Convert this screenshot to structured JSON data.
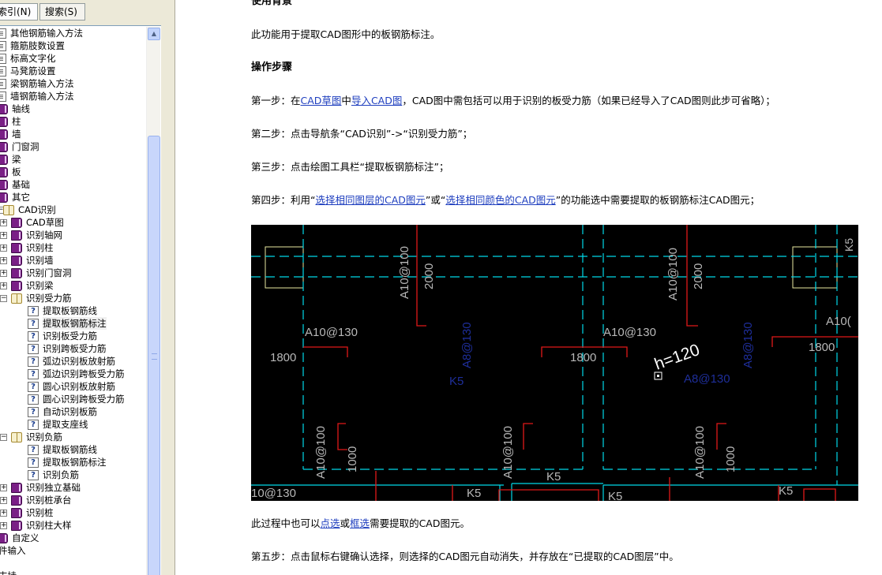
{
  "tabs": {
    "index": "索引(N)",
    "search": "搜索(S)"
  },
  "tree": [
    {
      "label": "其他钢筋输入方法",
      "icon": "page",
      "indent": 0
    },
    {
      "label": "箍筋肢数设置",
      "icon": "page",
      "indent": 0
    },
    {
      "label": "标高文字化",
      "icon": "page",
      "indent": 0
    },
    {
      "label": "马凳筋设置",
      "icon": "page",
      "indent": 0
    },
    {
      "label": "梁钢筋输入方法",
      "icon": "page",
      "indent": 0
    },
    {
      "label": "墙钢筋输入方法",
      "icon": "page",
      "indent": 0
    },
    {
      "label": "轴线",
      "icon": "book",
      "indent": 0
    },
    {
      "label": "柱",
      "icon": "book",
      "indent": 0
    },
    {
      "label": "墙",
      "icon": "book",
      "indent": 0
    },
    {
      "label": "门窗洞",
      "icon": "book",
      "indent": 0
    },
    {
      "label": "梁",
      "icon": "book",
      "indent": 0
    },
    {
      "label": "板",
      "icon": "book",
      "indent": 0
    },
    {
      "label": "基础",
      "icon": "book",
      "indent": 0
    },
    {
      "label": "其它",
      "icon": "book",
      "indent": 0
    },
    {
      "label": "CAD识别",
      "icon": "open",
      "indent": 0,
      "toggle": "−"
    },
    {
      "label": "CAD草图",
      "icon": "book",
      "indent": 1,
      "toggle": "+"
    },
    {
      "label": "识别轴网",
      "icon": "book",
      "indent": 1,
      "toggle": "+"
    },
    {
      "label": "识别柱",
      "icon": "book",
      "indent": 1,
      "toggle": "+"
    },
    {
      "label": "识别墙",
      "icon": "book",
      "indent": 1,
      "toggle": "+"
    },
    {
      "label": "识别门窗洞",
      "icon": "book",
      "indent": 1,
      "toggle": "+"
    },
    {
      "label": "识别梁",
      "icon": "book",
      "indent": 1,
      "toggle": "+"
    },
    {
      "label": "识别受力筋",
      "icon": "open",
      "indent": 1,
      "toggle": "−"
    },
    {
      "label": "提取板钢筋线",
      "icon": "q",
      "indent": 2
    },
    {
      "label": "提取板钢筋标注",
      "icon": "q",
      "indent": 2,
      "selected": true
    },
    {
      "label": "识别板受力筋",
      "icon": "q",
      "indent": 2
    },
    {
      "label": "识别跨板受力筋",
      "icon": "q",
      "indent": 2
    },
    {
      "label": "弧边识别板放射筋",
      "icon": "q",
      "indent": 2
    },
    {
      "label": "弧边识别跨板受力筋",
      "icon": "q",
      "indent": 2
    },
    {
      "label": "圆心识别板放射筋",
      "icon": "q",
      "indent": 2
    },
    {
      "label": "圆心识别跨板受力筋",
      "icon": "q",
      "indent": 2
    },
    {
      "label": "自动识别板筋",
      "icon": "q",
      "indent": 2
    },
    {
      "label": "提取支座线",
      "icon": "q",
      "indent": 2
    },
    {
      "label": "识别负筋",
      "icon": "open",
      "indent": 1,
      "toggle": "−"
    },
    {
      "label": "提取板钢筋线",
      "icon": "q",
      "indent": 2
    },
    {
      "label": "提取板钢筋标注",
      "icon": "q",
      "indent": 2
    },
    {
      "label": "识别负筋",
      "icon": "q",
      "indent": 2
    },
    {
      "label": "识别独立基础",
      "icon": "book",
      "indent": 1,
      "toggle": "+"
    },
    {
      "label": "识别桩承台",
      "icon": "book",
      "indent": 1,
      "toggle": "+"
    },
    {
      "label": "识别桩",
      "icon": "book",
      "indent": 1,
      "toggle": "+"
    },
    {
      "label": "识别柱大样",
      "icon": "book",
      "indent": 1,
      "toggle": "+"
    },
    {
      "label": "自定义",
      "icon": "book",
      "indent": 0
    },
    {
      "label": "件输入",
      "icon": "none",
      "indent": -1
    },
    {
      "label": "",
      "icon": "none",
      "indent": -1
    },
    {
      "label": "支持",
      "icon": "none",
      "indent": -1
    }
  ],
  "content": {
    "heading_background": "使用背景",
    "desc": "此功能用于提取CAD图形中的板钢筋标注。",
    "heading_steps": "操作步骤",
    "step1": {
      "prefix": "第一步：在",
      "link1": "CAD草图",
      "mid": "中",
      "link2": "导入CAD图",
      "suffix": "，CAD图中需包括可以用于识别的板受力筋（如果已经导入了CAD图则此步可省略）；"
    },
    "step2": "第二步：点击导航条“CAD识别”->“识别受力筋”；",
    "step3": "第三步：点击绘图工具栏“提取板钢筋标注”；",
    "step4": {
      "prefix": "第四步：利用“",
      "link1": "选择相同图层的CAD图元",
      "mid": "”或“",
      "link2": "选择相同颜色的CAD图元",
      "suffix": "”的功能选中需要提取的板钢筋标注CAD图元；"
    },
    "after_figure": {
      "prefix": "此过程中也可以",
      "link1": "点选",
      "mid": "或",
      "link2": "框选",
      "suffix": "需要提取的CAD图元。"
    },
    "step5": "第五步：点击鼠标右键确认选择，则选择的CAD图元自动消失，并存放在“已提取的CAD图层”中。"
  },
  "cad_figure": {
    "labels": {
      "a10_130": "A10@130",
      "a10_100": "A10@100",
      "a8_130": "A8@130",
      "d1800": "1800",
      "d2000": "2000",
      "d1000": "1000",
      "k5": "K5",
      "h120": "h=120",
      "a10_partial": "A10(",
      "a10_130_partial": "10@130"
    },
    "colors": {
      "background": "#000000",
      "axis": "#00d8e8",
      "rebar": "#e01818",
      "text_white": "#b8b8b8",
      "text_blue": "#1e2e9a",
      "column": "#e8e8a0"
    }
  }
}
